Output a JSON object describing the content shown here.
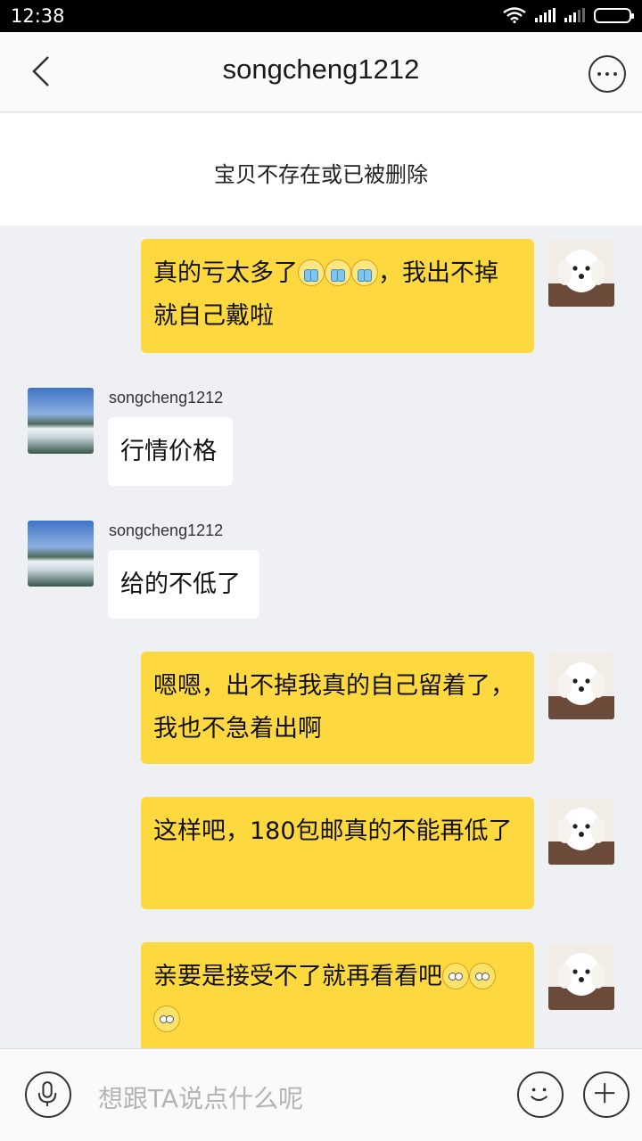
{
  "status_bar": {
    "time": "12:38"
  },
  "header": {
    "title": "songcheng1212"
  },
  "notice": "宝贝不存在或已被删除",
  "messages": [
    {
      "from": "me",
      "text_before": "真的亏太多了",
      "emojis": [
        "cry",
        "cry",
        "cry"
      ],
      "text_after": "，我出不掉就自己戴啦"
    },
    {
      "from": "other",
      "sender": "songcheng1212",
      "text": "行情价格"
    },
    {
      "from": "other",
      "sender": "songcheng1212",
      "text": "给的不低了"
    },
    {
      "from": "me",
      "text": "嗯嗯，出不掉我真的自己留着了，我也不急着出啊"
    },
    {
      "from": "me",
      "text": "这样吧，180包邮真的不能再低了"
    },
    {
      "from": "me",
      "text": "亲要是接受不了就再看看吧",
      "emojis": [
        "smile",
        "smile",
        "smile"
      ]
    }
  ],
  "input": {
    "placeholder": "想跟TA说点什么呢"
  },
  "icons": {
    "back": "chevron-left-icon",
    "more": "more-horizontal-icon",
    "mic": "microphone-icon",
    "emoji": "smiley-icon",
    "plus": "plus-icon"
  }
}
